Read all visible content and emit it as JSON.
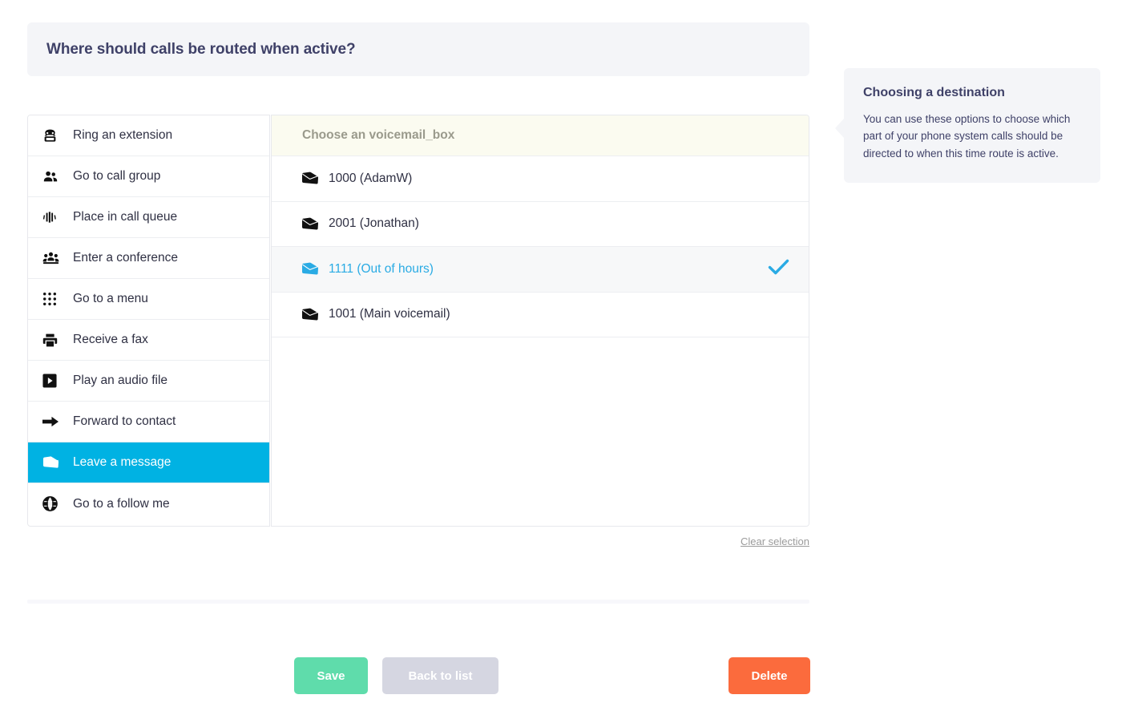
{
  "question": {
    "title": "Where should calls be routed when active?"
  },
  "destinations": {
    "items": [
      {
        "label": "Ring an extension",
        "icon": "telephone-icon",
        "active": false
      },
      {
        "label": "Go to call group",
        "icon": "users-icon",
        "active": false
      },
      {
        "label": "Place in call queue",
        "icon": "signal-bars-icon",
        "active": false
      },
      {
        "label": "Enter a conference",
        "icon": "conference-icon",
        "active": false
      },
      {
        "label": "Go to a menu",
        "icon": "grid-dots-icon",
        "active": false
      },
      {
        "label": "Receive a fax",
        "icon": "fax-printer-icon",
        "active": false
      },
      {
        "label": "Play an audio file",
        "icon": "play-square-icon",
        "active": false
      },
      {
        "label": "Forward to contact",
        "icon": "arrow-right-icon",
        "active": false
      },
      {
        "label": "Leave a message",
        "icon": "envelope-icon",
        "active": true
      },
      {
        "label": "Go to a follow me",
        "icon": "globe-icon",
        "active": false
      }
    ]
  },
  "options": {
    "header": "Choose an voicemail_box",
    "items": [
      {
        "label": "1000 (AdamW)",
        "icon": "envelope-icon",
        "selected": false
      },
      {
        "label": "2001 (Jonathan)",
        "icon": "envelope-icon",
        "selected": false
      },
      {
        "label": "1111 (Out of hours)",
        "icon": "envelope-icon",
        "selected": true
      },
      {
        "label": "1001 (Main voicemail)",
        "icon": "envelope-icon",
        "selected": false
      }
    ],
    "clear_label": "Clear selection"
  },
  "actions": {
    "save_label": "Save",
    "back_label": "Back to list",
    "delete_label": "Delete"
  },
  "help": {
    "title": "Choosing a destination",
    "text": "You can use these options to choose which part of your phone system calls should be directed to when this time route is active."
  },
  "colors": {
    "accent": "#00b2e3",
    "selected_text": "#2aabe4",
    "heading": "#3f4168",
    "save": "#5fdcab",
    "back": "#d5d6e1",
    "delete": "#fb6b3d",
    "panel_bg": "#f4f5f8",
    "option_header_bg": "#fbfbf0"
  }
}
